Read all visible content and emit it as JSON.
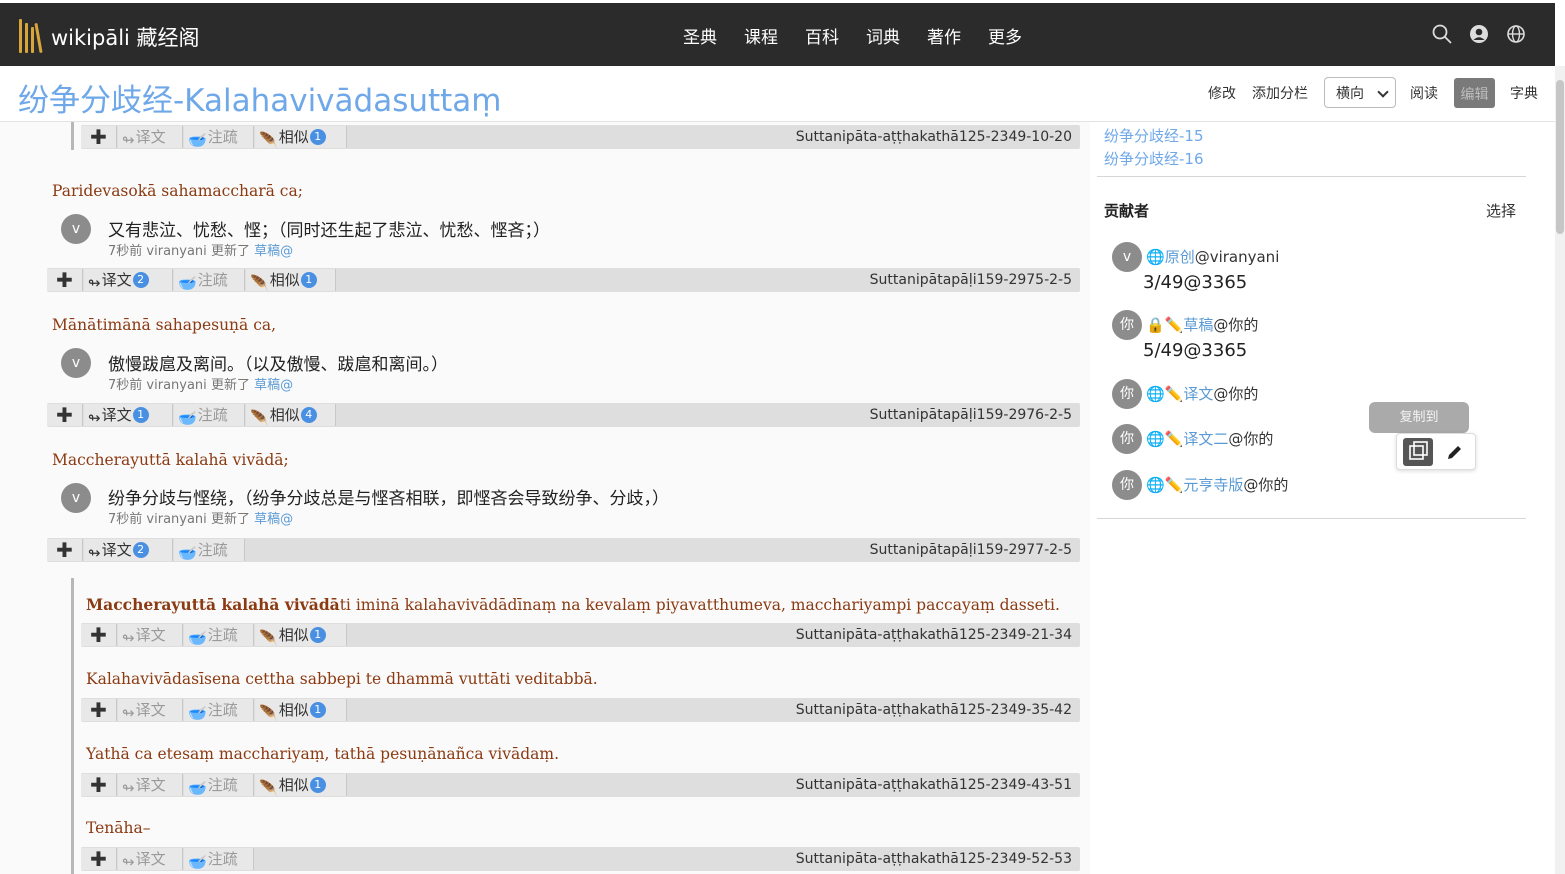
{
  "nav": {
    "brand": "wikipāli 藏经阁",
    "items": [
      "圣典",
      "课程",
      "百科",
      "词典",
      "著作",
      "更多"
    ],
    "icons": [
      "search-icon",
      "user-icon",
      "globe-icon"
    ]
  },
  "header": {
    "title": "纷争分歧经-Kalahavivādasuttaṃ",
    "actions": {
      "modify": "修改",
      "add_column": "添加分栏",
      "orientation": "横向",
      "read": "阅读",
      "edit": "编辑",
      "dictionary": "字典"
    }
  },
  "labels": {
    "translation": "译文",
    "commentary": "注疏",
    "similar": "相似",
    "meta_time": "7秒前",
    "meta_updated": "更新了",
    "meta_draft": "草稿@"
  },
  "blocks": [
    {
      "toolbar": {
        "has_trans_count": false,
        "similar": "1",
        "id": "Suttanipāta-aṭṭhakathā125-2349-10-20"
      }
    },
    {
      "pali": "Paridevasokā sahamaccharā ca;",
      "translation": "又有悲泣、忧愁、悭；（同时还生起了悲泣、忧愁、悭吝；）",
      "avatar": "v",
      "user": "viranyani",
      "toolbar": {
        "trans": "2",
        "similar": "1",
        "id": "Suttanipātapāḷi159-2975-2-5"
      }
    },
    {
      "pali": "Mānātimānā sahapesuṇā ca,",
      "translation": "傲慢跋扈及离间。（以及傲慢、跋扈和离间。）",
      "avatar": "v",
      "user": "viranyani",
      "toolbar": {
        "trans": "1",
        "similar": "4",
        "id": "Suttanipātapāḷi159-2976-2-5"
      }
    },
    {
      "pali": "Maccherayuttā kalahā vivādā;",
      "translation": "纷争分歧与悭绕，（纷争分歧总是与悭吝相联，即悭吝会导致纷争、分歧，）",
      "avatar": "v",
      "user": "viranyani",
      "toolbar": {
        "trans": "2",
        "similar": "",
        "id": "Suttanipātapāḷi159-2977-2-5"
      }
    }
  ],
  "commentary": [
    {
      "pali_bold": "Maccherayuttā kalahā vivādā",
      "pali": "ti iminā kalahavivādādīnaṃ na kevalaṃ piyavatthumeva, macchariyampi paccayaṃ dasseti.",
      "toolbar": {
        "similar": "1",
        "id": "Suttanipāta-aṭṭhakathā125-2349-21-34"
      }
    },
    {
      "pali_bold": "",
      "pali": "Kalahavivādasīsena cettha sabbepi te dhammā vuttāti veditabbā.",
      "toolbar": {
        "similar": "1",
        "id": "Suttanipāta-aṭṭhakathā125-2349-35-42"
      }
    },
    {
      "pali_bold": "",
      "pali": "Yathā ca etesaṃ macchariyaṃ, tathā pesuṇānañca vivādaṃ.",
      "toolbar": {
        "similar": "1",
        "id": "Suttanipāta-aṭṭhakathā125-2349-43-51"
      }
    },
    {
      "pali_bold": "",
      "pali": "Tenāha–",
      "toolbar": {
        "similar": "",
        "id": "Suttanipāta-aṭṭhakathā125-2349-52-53"
      }
    }
  ],
  "sidebar": {
    "toc": [
      "纷争分歧经-15",
      "纷争分歧经-16"
    ],
    "contributors_title": "贡献者",
    "select": "选择",
    "contributors": [
      {
        "avatar": "v",
        "name": "原创",
        "owner": "@viranyani",
        "sub": "3/49@3365"
      },
      {
        "avatar": "你",
        "name": "草稿",
        "owner": "@你的",
        "sub": "5/49@3365"
      },
      {
        "avatar": "你",
        "name": "译文",
        "owner": "@你的",
        "sub": ""
      },
      {
        "avatar": "你",
        "name": "译文二",
        "owner": "@你的",
        "sub": ""
      },
      {
        "avatar": "你",
        "name": "元亨寺版",
        "owner": "@你的",
        "sub": ""
      }
    ],
    "tooltip": "复制到"
  },
  "colors": {
    "nav_bg": "#2b2b2b",
    "title": "#6fa8e8",
    "pali": "#8b3a12",
    "badge": "#4a90e2",
    "link": "#5b9bd5"
  }
}
